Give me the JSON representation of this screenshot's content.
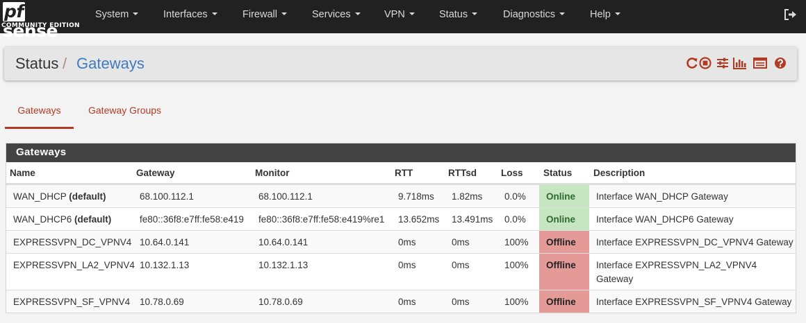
{
  "brand": {
    "name": "pfsense",
    "name_pf": "pf",
    "name_rest": "sense",
    "edition": "COMMUNITY EDITION"
  },
  "nav": [
    {
      "label": "System"
    },
    {
      "label": "Interfaces"
    },
    {
      "label": "Firewall"
    },
    {
      "label": "Services"
    },
    {
      "label": "VPN"
    },
    {
      "label": "Status"
    },
    {
      "label": "Diagnostics"
    },
    {
      "label": "Help"
    }
  ],
  "breadcrumb": {
    "parent": "Status",
    "separator": "/",
    "current": "Gateways"
  },
  "toolbar_icons": [
    "reload-icon",
    "stop-icon",
    "settings-sliders-icon",
    "bar-chart-icon",
    "table-icon",
    "help-icon"
  ],
  "tabs": [
    {
      "label": "Gateways",
      "active": true
    },
    {
      "label": "Gateway Groups",
      "active": false
    }
  ],
  "panel": {
    "title": "Gateways",
    "columns": [
      "Name",
      "Gateway",
      "Monitor",
      "RTT",
      "RTTsd",
      "Loss",
      "Status",
      "Description"
    ],
    "rows": [
      {
        "name": "WAN_DHCP",
        "default": "(default)",
        "gateway": "68.100.112.1",
        "monitor": "68.100.112.1",
        "rtt": "9.718ms",
        "rttsd": "1.82ms",
        "loss": "0.0%",
        "status": "Online",
        "description": "Interface WAN_DHCP Gateway"
      },
      {
        "name": "WAN_DHCP6",
        "default": "(default)",
        "gateway": "fe80::36f8:e7ff:fe58:e419",
        "monitor": "fe80::36f8:e7ff:fe58:e419%re1",
        "rtt": "13.652ms",
        "rttsd": "13.491ms",
        "loss": "0.0%",
        "status": "Online",
        "description": "Interface WAN_DHCP6 Gateway"
      },
      {
        "name": "EXPRESSVPN_DC_VPNV4",
        "default": "",
        "gateway": "10.64.0.141",
        "monitor": "10.64.0.141",
        "rtt": "0ms",
        "rttsd": "0ms",
        "loss": "100%",
        "status": "Offline",
        "description": "Interface EXPRESSVPN_DC_VPNV4 Gateway"
      },
      {
        "name": "EXPRESSVPN_LA2_VPNV4",
        "default": "",
        "gateway": "10.132.1.13",
        "monitor": "10.132.1.13",
        "rtt": "0ms",
        "rttsd": "0ms",
        "loss": "100%",
        "status": "Offline",
        "description": "Interface EXPRESSVPN_LA2_VPNV4 Gateway"
      },
      {
        "name": "EXPRESSVPN_SF_VPNV4",
        "default": "",
        "gateway": "10.78.0.69",
        "monitor": "10.78.0.69",
        "rtt": "0ms",
        "rttsd": "0ms",
        "loss": "100%",
        "status": "Offline",
        "description": "Interface EXPRESSVPN_SF_VPNV4 Gateway"
      }
    ]
  },
  "colors": {
    "navbar": "#212121",
    "accent": "#b33a22",
    "online": "#c6e5c1",
    "offline": "#e49b98",
    "link_blue": "#3e7bbf"
  }
}
